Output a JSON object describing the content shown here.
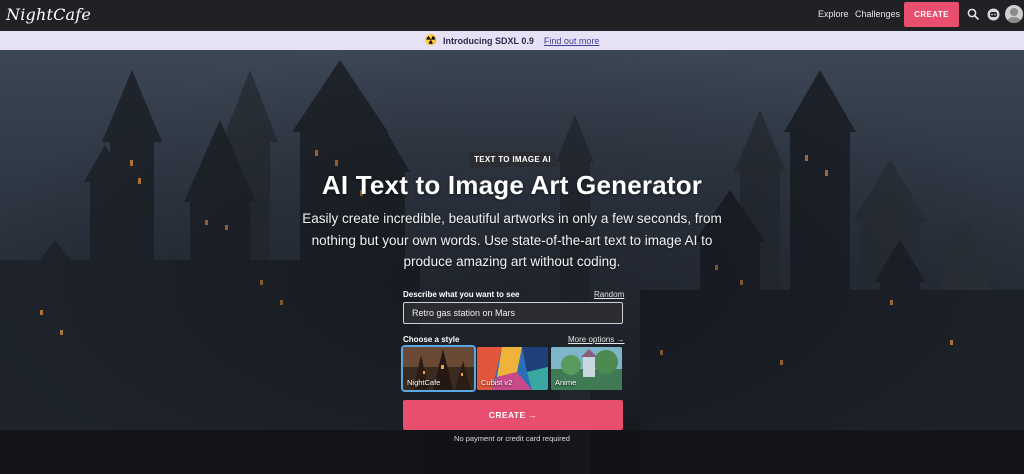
{
  "topbar": {
    "logo": "NightCafe",
    "nav": [
      "Explore",
      "Challenges"
    ],
    "create_label": "CREATE",
    "icons": [
      "search-icon",
      "discord-icon",
      "avatar"
    ]
  },
  "announcement": {
    "emoji": "☢️",
    "text": "Introducing SDXL 0.9",
    "link": "Find out more"
  },
  "hero": {
    "badge": "TEXT TO IMAGE AI",
    "title": "AI Text to Image Art Generator",
    "subtitle": "Easily create incredible, beautiful artworks in only a few seconds, from nothing but your own words. Use state-of-the-art text to image AI to produce amazing art without coding."
  },
  "form": {
    "prompt_label": "Describe what you want to see",
    "random_label": "Random",
    "prompt_value": "Retro gas station on Mars",
    "style_label": "Choose a style",
    "more_options": "More options →",
    "styles": [
      {
        "name": "NightCafe",
        "selected": true
      },
      {
        "name": "Cubist v2",
        "selected": false
      },
      {
        "name": "Anime",
        "selected": false
      }
    ],
    "create_label": "CREATE →",
    "note": "No payment or credit card required"
  },
  "colors": {
    "accent": "#e84e6e",
    "topbar": "#1f2125",
    "announcement_bg": "#e7e1f6",
    "selected_outline": "#5aa7e6"
  }
}
